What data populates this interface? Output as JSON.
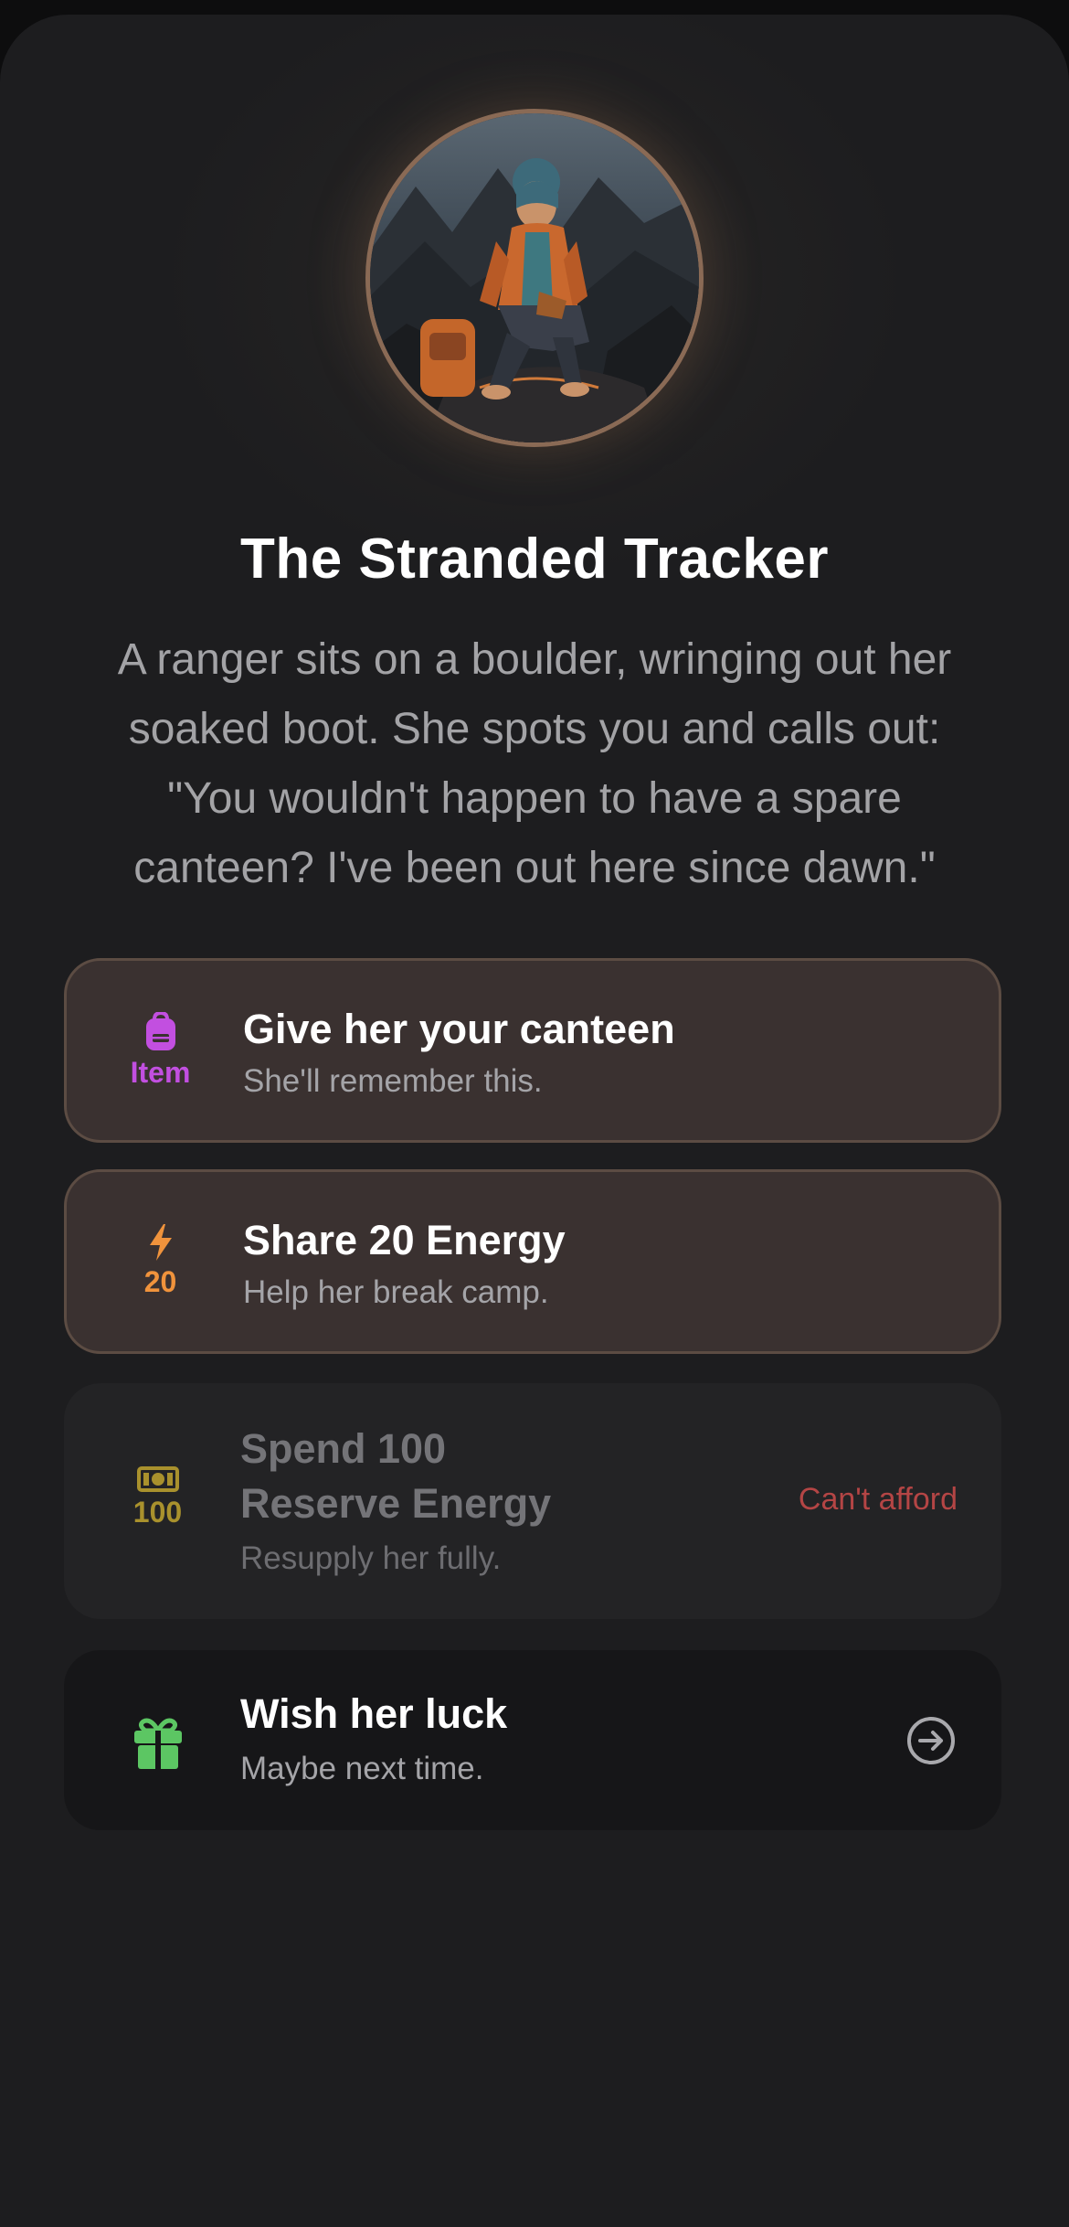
{
  "event": {
    "title": "The Stranded Tracker",
    "description": "A ranger sits on a boulder, wringing out her soaked boot. She spots you and calls out: \"You wouldn't happen to have a spare canteen? I've been out here since dawn.\"",
    "portrait": "ranger-portrait"
  },
  "options": [
    {
      "icon": "backpack-icon",
      "cost_label": "Item",
      "cost_color": "#c24fe0",
      "label": "Give her your canteen",
      "sub": "She'll remember this.",
      "state": "available"
    },
    {
      "icon": "lightning-icon",
      "cost_label": "20",
      "cost_color": "#f0933c",
      "label": "Share 20 Energy",
      "sub": "Help her break camp.",
      "state": "available"
    },
    {
      "icon": "cash-icon",
      "cost_label": "100",
      "cost_color": "#a9912d",
      "label_line1": "Spend 100",
      "label_line2": "Reserve Energy",
      "sub": "Resupply her fully.",
      "status": "Can't afford",
      "state": "disabled"
    },
    {
      "icon": "gift-icon",
      "icon_color": "#5cc663",
      "label": "Wish her luck",
      "sub": "Maybe next time.",
      "trailing_icon": "arrow-right-circle-icon",
      "state": "available"
    }
  ]
}
